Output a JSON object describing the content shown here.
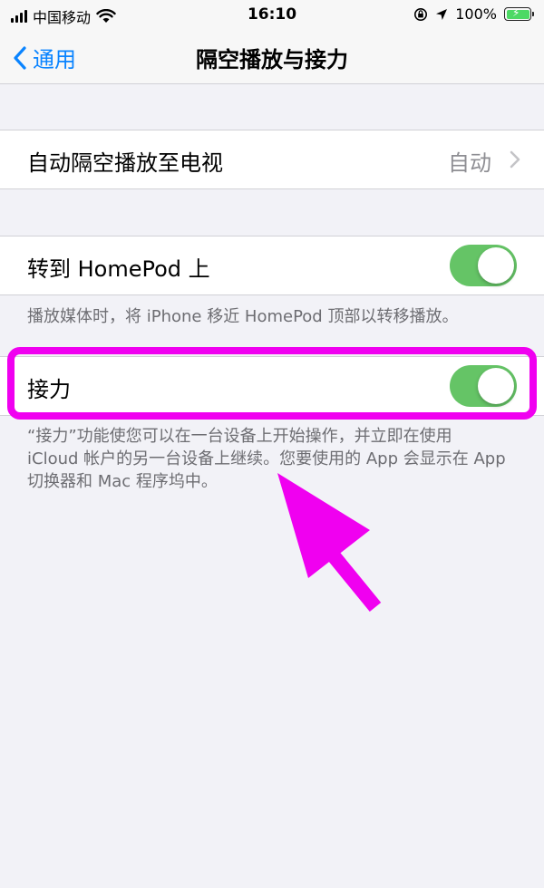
{
  "status_bar": {
    "carrier": "中国移动",
    "time": "16:10",
    "battery": "100%"
  },
  "nav": {
    "back_label": "通用",
    "title": "隔空播放与接力"
  },
  "airplay_row": {
    "label": "自动隔空播放至电视",
    "value": "自动"
  },
  "homepod_row": {
    "label": "转到 HomePod 上",
    "toggle_on": true,
    "footnote": "播放媒体时，将 iPhone 移近 HomePod 顶部以转移播放。"
  },
  "handoff_row": {
    "label": "接力",
    "toggle_on": true,
    "footnote_lines": [
      "“接力”功能使您可以在一台设备上开始操作，并立即在使用",
      "iCloud 帐户的另一台设备上继续。您要使用的 App 会显示在 App",
      "切换器和 Mac 程序坞中。"
    ]
  },
  "colors": {
    "accent": "#0a84ff",
    "toggle_on": "#65c466",
    "annotation": "#f000f0"
  }
}
